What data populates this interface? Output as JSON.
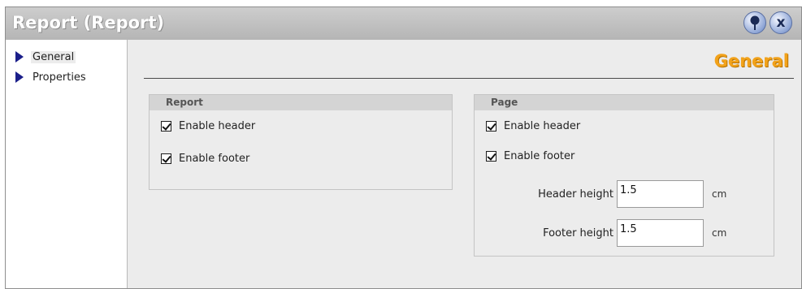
{
  "window": {
    "title": "Report (Report)"
  },
  "titlebar_buttons": {
    "pin_icon": "pin-icon",
    "close_label": "x"
  },
  "nav": {
    "items": [
      {
        "label": "General",
        "selected": true
      },
      {
        "label": "Properties",
        "selected": false
      }
    ]
  },
  "content": {
    "section_title": "General",
    "report_group": {
      "title": "Report",
      "enable_header": {
        "label": "Enable header",
        "checked": true
      },
      "enable_footer": {
        "label": "Enable footer",
        "checked": true
      }
    },
    "page_group": {
      "title": "Page",
      "enable_header": {
        "label": "Enable header",
        "checked": true
      },
      "enable_footer": {
        "label": "Enable footer",
        "checked": true
      },
      "header_height": {
        "label": "Header height",
        "value": "1.5",
        "unit": "cm"
      },
      "footer_height": {
        "label": "Footer height",
        "value": "1.5",
        "unit": "cm"
      }
    }
  },
  "colors": {
    "accent_title": "#f2a21a",
    "nav_arrow": "#1b1f8a",
    "titlebar": "#bebebe"
  }
}
